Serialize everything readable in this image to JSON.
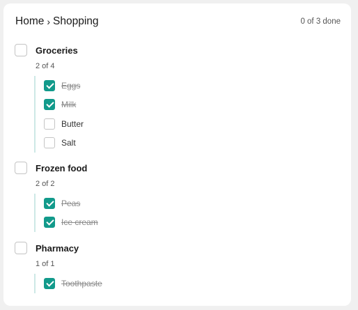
{
  "header": {
    "breadcrumb_home": "Home",
    "breadcrumb_separator": "›",
    "breadcrumb_current": "Shopping",
    "progress": "0 of 3 done"
  },
  "groups": [
    {
      "title": "Groceries",
      "count": "2 of 4",
      "checked": false,
      "items": [
        {
          "label": "Eggs",
          "checked": true
        },
        {
          "label": "Milk",
          "checked": true
        },
        {
          "label": "Butter",
          "checked": false
        },
        {
          "label": "Salt",
          "checked": false
        }
      ]
    },
    {
      "title": "Frozen food",
      "count": "2 of 2",
      "checked": false,
      "items": [
        {
          "label": "Peas",
          "checked": true
        },
        {
          "label": "Ice cream",
          "checked": true
        }
      ]
    },
    {
      "title": "Pharmacy",
      "count": "1 of 1",
      "checked": false,
      "items": [
        {
          "label": "Toothpaste",
          "checked": true
        }
      ]
    }
  ],
  "colors": {
    "accent": "#129a8b",
    "rail": "#cde8e6"
  }
}
